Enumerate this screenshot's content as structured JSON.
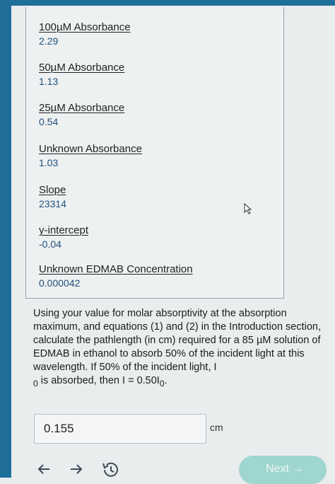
{
  "values": [
    {
      "label": "100µM Absorbance",
      "value": "2.29"
    },
    {
      "label": "50µM Absorbance",
      "value": "1.13"
    },
    {
      "label": "25µM Absorbance",
      "value": "0.54"
    },
    {
      "label": "Unknown Absorbance",
      "value": "1.03"
    },
    {
      "label": "Slope",
      "value": "23314"
    },
    {
      "label": "y-intercept",
      "value": "-0.04"
    },
    {
      "label": "Unknown EDMAB Concentration",
      "value": "0.000042"
    }
  ],
  "question": {
    "text_main": "Using your value for molar absorptivity at the absorption maximum, and equations (1) and (2) in the Introduction section, calculate the pathlength (in cm) required for a 85 µM solution of EDMAB in ethanol to absorb 50% of the incident light at this wavelength. If 50% of the incident light, I",
    "sub_zero_a": "0",
    "text_tail": " is absorbed, then I = 0.50I",
    "sub_zero_b": "0",
    "text_end": "."
  },
  "answer": {
    "value": "0.155",
    "unit": "cm"
  },
  "nav": {
    "next_label": "Next",
    "back_icon": "arrow-left-icon",
    "forward_icon": "arrow-right-icon",
    "history_icon": "history-icon"
  },
  "colors": {
    "value_text": "#1f4f7a",
    "frame": "#1f6f9a",
    "next_button": "#9fd6cf"
  }
}
